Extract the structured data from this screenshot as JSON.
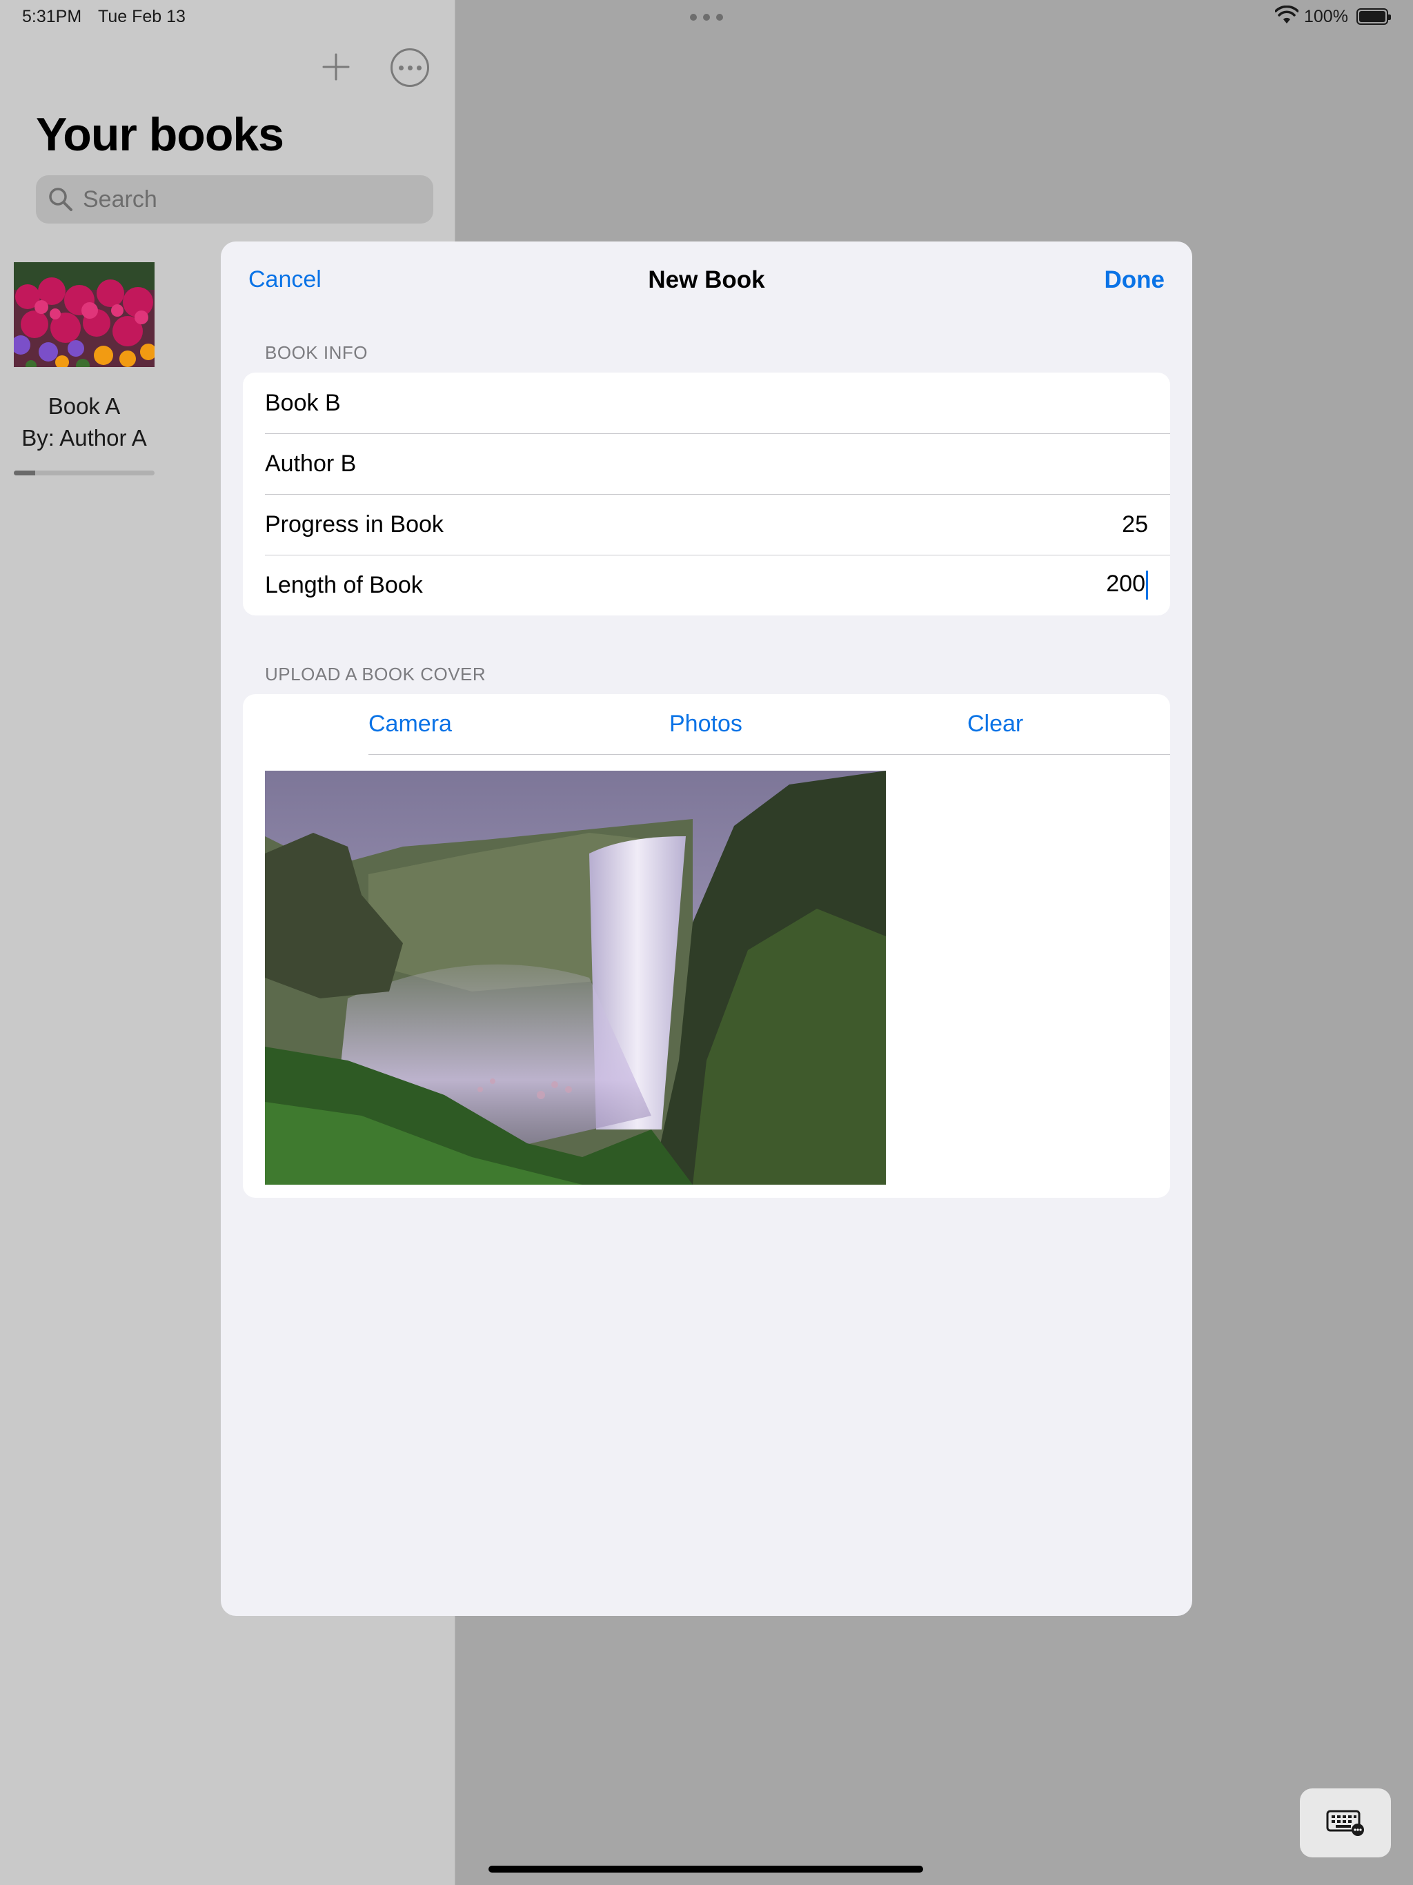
{
  "status_bar": {
    "time": "5:31PM",
    "date": "Tue Feb 13",
    "battery": "100%"
  },
  "sidebar": {
    "title": "Your books",
    "search_placeholder": "Search",
    "books": [
      {
        "title": "Book A",
        "author": "By: Author A",
        "progress": 0.15
      }
    ]
  },
  "modal": {
    "cancel_label": "Cancel",
    "title": "New Book",
    "done_label": "Done",
    "book_info": {
      "header": "BOOK INFO",
      "title_value": "Book B",
      "author_value": "Author B",
      "progress_label": "Progress in Book",
      "progress_value": "25",
      "length_label": "Length of Book",
      "length_value": "200"
    },
    "cover": {
      "header": "UPLOAD A BOOK COVER",
      "camera_label": "Camera",
      "photos_label": "Photos",
      "clear_label": "Clear"
    }
  },
  "colors": {
    "accent": "#0a73e6",
    "dim_background": "#a6a6a6",
    "modal_background": "#f1f1f6"
  },
  "icons": [
    "wifi-icon",
    "battery-icon",
    "plus-icon",
    "ellipsis-circle-icon",
    "search-icon",
    "keyboard-icon"
  ]
}
